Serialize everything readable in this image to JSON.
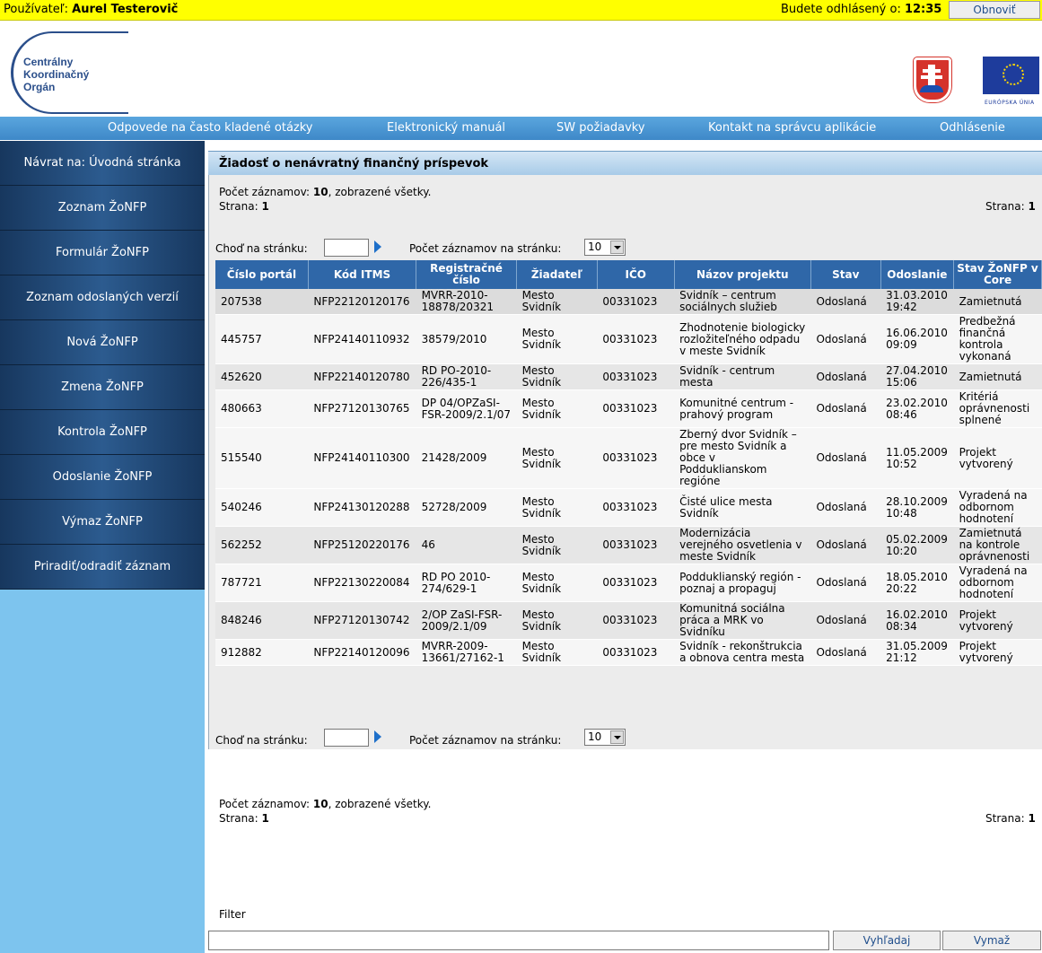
{
  "topbar": {
    "user_label": "Používateľ:",
    "user_name": "Aurel Testerovič",
    "logout_label": "Budete odhlásený o:",
    "logout_time": "12:35",
    "refresh_label": "Obnoviť"
  },
  "header": {
    "logo_line1": "Centrálny",
    "logo_line2": "Koordinačný",
    "logo_line3": "Orgán",
    "eu_label": "EURÓPSKA ÚNIA"
  },
  "nav": {
    "items": [
      "Odpovede na často kladené otázky",
      "Elektronický manuál",
      "SW požiadavky",
      "Kontakt na správcu aplikácie",
      "Odhlásenie"
    ]
  },
  "sidebar": {
    "items": [
      "Návrat na: Úvodná stránka",
      "Zoznam ŽoNFP",
      "Formulár ŽoNFP",
      "Zoznam odoslaných verzií",
      "Nová ŽoNFP",
      "Zmena ŽoNFP",
      "Kontrola ŽoNFP",
      "Odoslanie ŽoNFP",
      "Výmaz ŽoNFP",
      "Priradiť/odradiť záznam"
    ]
  },
  "panel": {
    "title": "Žiadosť o nenávratný finančný príspevok",
    "count_label": "Počet záznamov:",
    "count_value": "10",
    "count_suffix": ", zobrazené všetky.",
    "page_label": "Strana:",
    "page_value": "1",
    "goto_label": "Choď na stránku:",
    "per_page_label": "Počet záznamov na stránku:",
    "per_page_value": "10"
  },
  "table": {
    "headers": [
      "Číslo portál",
      "Kód ITMS",
      "Registračné číslo",
      "Žiadateľ",
      "IČO",
      "Názov projektu",
      "Stav",
      "Odoslanie",
      "Stav ŽoNFP v Core"
    ],
    "rows": [
      [
        "207538",
        "NFP22120120176",
        "MVRR-2010-18878/20321",
        "Mesto Svidník",
        "00331023",
        "Svidník – centrum sociálnych služieb",
        "Odoslaná",
        "31.03.2010 19:42",
        "Zamietnutá"
      ],
      [
        "445757",
        "NFP24140110932",
        "38579/2010",
        "Mesto Svidník",
        "00331023",
        "Zhodnotenie biologicky rozložiteľného odpadu v meste Svidník",
        "Odoslaná",
        "16.06.2010 09:09",
        "Predbežná finančná kontrola vykonaná"
      ],
      [
        "452620",
        "NFP22140120780",
        "RD PO-2010-226/435-1",
        "Mesto Svidník",
        "00331023",
        "Svidník - centrum mesta",
        "Odoslaná",
        "27.04.2010 15:06",
        "Zamietnutá"
      ],
      [
        "480663",
        "NFP27120130765",
        "DP 04/OPZaSI-FSR-2009/2.1/07",
        "Mesto Svidník",
        "00331023",
        "Komunitné centrum - prahový program",
        "Odoslaná",
        "23.02.2010 08:46",
        "Kritériá oprávnenosti splnené"
      ],
      [
        "515540",
        "NFP24140110300",
        "21428/2009",
        "Mesto Svidník",
        "00331023",
        "Zberný dvor Svidník – pre mesto Svidník a obce v Podduklianskom regióne",
        "Odoslaná",
        "11.05.2009 10:52",
        "Projekt vytvorený"
      ],
      [
        "540246",
        "NFP24130120288",
        "52728/2009",
        "Mesto Svidník",
        "00331023",
        "Čisté ulice mesta Svidník",
        "Odoslaná",
        "28.10.2009 10:48",
        "Vyradená na odbornom hodnotení"
      ],
      [
        "562252",
        "NFP25120220176",
        "46",
        "Mesto Svidník",
        "00331023",
        "Modernizácia verejného osvetlenia v meste Svidník",
        "Odoslaná",
        "05.02.2009 10:20",
        "Zamietnutá na kontrole oprávnenosti"
      ],
      [
        "787721",
        "NFP22130220084",
        "RD PO 2010-274/629-1",
        "Mesto Svidník",
        "00331023",
        "Podduklianský región - poznaj a propaguj",
        "Odoslaná",
        "18.05.2010 20:22",
        "Vyradená na odbornom hodnotení"
      ],
      [
        "848246",
        "NFP27120130742",
        "2/OP ZaSI-FSR-2009/2.1/09",
        "Mesto Svidník",
        "00331023",
        "Komunitná sociálna práca a MRK vo Svidníku",
        "Odoslaná",
        "16.02.2010 08:34",
        "Projekt vytvorený"
      ],
      [
        "912882",
        "NFP22140120096",
        "MVRR-2009-13661/27162-1",
        "Mesto Svidník",
        "00331023",
        "Svidník - rekonštrukcia a obnova centra mesta",
        "Odoslaná",
        "31.05.2009 21:12",
        "Projekt vytvorený"
      ]
    ]
  },
  "filter": {
    "label": "Filter",
    "search_label": "Vyhľadaj",
    "clear_label": "Vymaž"
  }
}
